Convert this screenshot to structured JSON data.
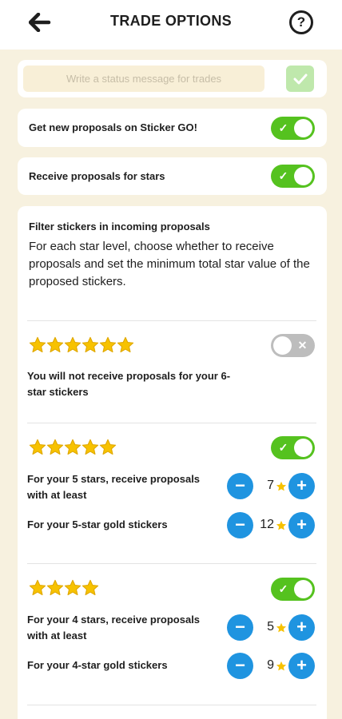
{
  "header": {
    "title": "TRADE OPTIONS",
    "back_icon": "back-arrow-icon",
    "help_icon": "help-icon",
    "help_glyph": "?"
  },
  "status": {
    "placeholder": "Write a status message for trades",
    "confirm_icon": "check-icon"
  },
  "settings": [
    {
      "label": "Get new proposals on Sticker GO!",
      "enabled": true
    },
    {
      "label": "Receive proposals for stars",
      "enabled": true
    }
  ],
  "filter": {
    "title": "Filter stickers in incoming proposals",
    "description": "For each star level, choose whether to receive proposals and set the minimum total star value of the proposed stickers.",
    "levels": [
      {
        "stars": 6,
        "enabled": false,
        "message": "You will not receive proposals for your 6-star stickers"
      },
      {
        "stars": 5,
        "enabled": true,
        "rows": [
          {
            "label": "For your 5 stars, receive proposals with at least",
            "value": "7"
          },
          {
            "label": "For your 5-star gold stickers",
            "value": "12"
          }
        ]
      },
      {
        "stars": 4,
        "enabled": true,
        "rows": [
          {
            "label": "For your 4 stars, receive proposals with at least",
            "value": "5"
          },
          {
            "label": "For your 4-star gold stickers",
            "value": "9"
          }
        ]
      }
    ]
  },
  "colors": {
    "background": "#f7f1df",
    "toggle_on": "#55c21f",
    "toggle_off": "#bdbdbd",
    "stepper": "#1f94e0",
    "star": "#f7c200"
  }
}
